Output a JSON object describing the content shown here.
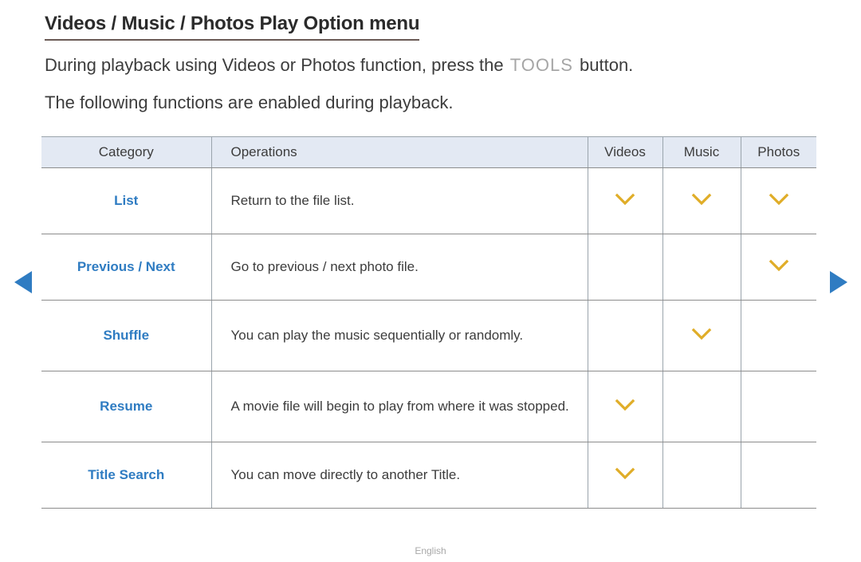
{
  "title": "Videos / Music / Photos Play Option menu",
  "intro": {
    "line1_before": "During playback using Videos or Photos function, press the ",
    "line1_key": "TOOLS",
    "line1_after": " button.",
    "line2": "The following functions are enabled during playback."
  },
  "table": {
    "headers": {
      "category": "Category",
      "operations": "Operations",
      "videos": "Videos",
      "music": "Music",
      "photos": "Photos"
    },
    "rows": [
      {
        "category": "List",
        "operations": "Return to the file list.",
        "videos": true,
        "music": true,
        "photos": true
      },
      {
        "category": "Previous / Next",
        "operations": "Go to previous / next photo file.",
        "videos": false,
        "music": false,
        "photos": true
      },
      {
        "category": "Shuffle",
        "operations": "You can play the music sequentially or randomly.",
        "videos": false,
        "music": true,
        "photos": false
      },
      {
        "category": "Resume",
        "operations": "A movie file will begin to play from where it was stopped.",
        "videos": true,
        "music": false,
        "photos": false
      },
      {
        "category": "Title Search",
        "operations": "You can move directly to another Title.",
        "videos": true,
        "music": false,
        "photos": false
      }
    ]
  },
  "navigation": {
    "previous_label": "previous-page-arrow",
    "next_label": "next-page-arrow"
  },
  "footer": {
    "language": "English"
  },
  "colors": {
    "category_blue": "#2f7cc2",
    "check_gold": "#e0ad28",
    "nav_blue": "#2f7cc2",
    "header_bg": "#e3e9f3",
    "title_underline": "#6a5a55",
    "tools_gray": "#a6a6a6"
  }
}
